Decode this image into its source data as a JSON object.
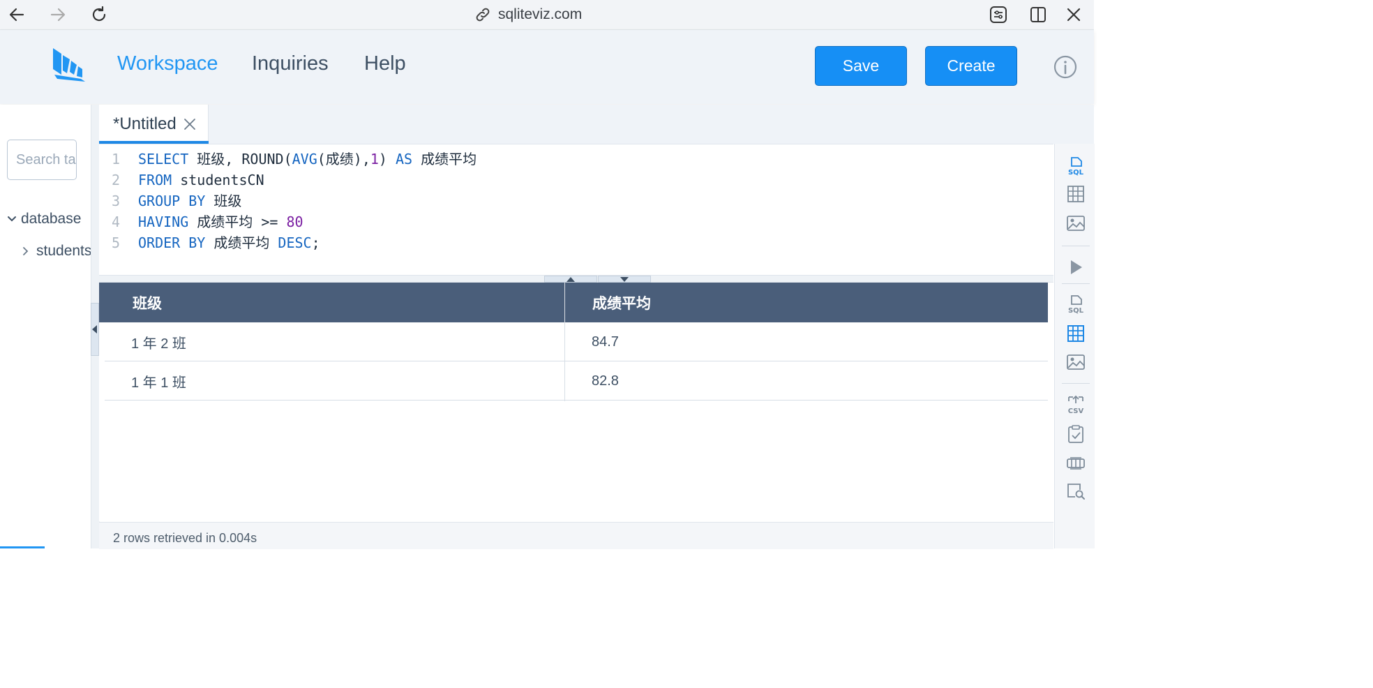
{
  "browser": {
    "url": "sqliteviz.com"
  },
  "header": {
    "nav": {
      "workspace": "Workspace",
      "inquiries": "Inquiries",
      "help": "Help"
    },
    "save_label": "Save",
    "create_label": "Create"
  },
  "sidebar": {
    "search_placeholder": "Search tables",
    "database_label": "database",
    "table_label": "studentsCN"
  },
  "tab": {
    "title": "*Untitled"
  },
  "editor": {
    "lines": [
      {
        "n": "1",
        "parts": [
          [
            "kw",
            "SELECT"
          ],
          [
            "t",
            " 班级, ROUND("
          ],
          [
            "kw",
            "AVG"
          ],
          [
            "t",
            "(成绩),"
          ],
          [
            "num",
            "1"
          ],
          [
            "t",
            ") "
          ],
          [
            "kw",
            "AS"
          ],
          [
            "t",
            " 成绩平均"
          ]
        ]
      },
      {
        "n": "2",
        "parts": [
          [
            "kw",
            "FROM"
          ],
          [
            "t",
            " studentsCN"
          ]
        ]
      },
      {
        "n": "3",
        "parts": [
          [
            "kw",
            "GROUP BY"
          ],
          [
            "t",
            " 班级"
          ]
        ]
      },
      {
        "n": "4",
        "parts": [
          [
            "kw",
            "HAVING"
          ],
          [
            "t",
            " 成绩平均 >= "
          ],
          [
            "num",
            "80"
          ]
        ]
      },
      {
        "n": "5",
        "parts": [
          [
            "kw",
            "ORDER BY"
          ],
          [
            "t",
            " 成绩平均 "
          ],
          [
            "kw",
            "DESC"
          ],
          [
            "t",
            ";"
          ]
        ]
      }
    ]
  },
  "result": {
    "columns": [
      "班级",
      "成绩平均"
    ],
    "rows": [
      [
        "1 年 2 班",
        "84.7"
      ],
      [
        "1 年 1 班",
        "82.8"
      ]
    ]
  },
  "status": {
    "text": "2 rows retrieved in 0.004s"
  },
  "right_toolbar": {
    "sql_label": "SQL",
    "csv_label": "CSV"
  },
  "colors": {
    "accent": "#2196f3",
    "button": "#168ff5",
    "table_header": "#4a5e7a",
    "keyword": "#1565c0",
    "number": "#7b1fa2"
  }
}
